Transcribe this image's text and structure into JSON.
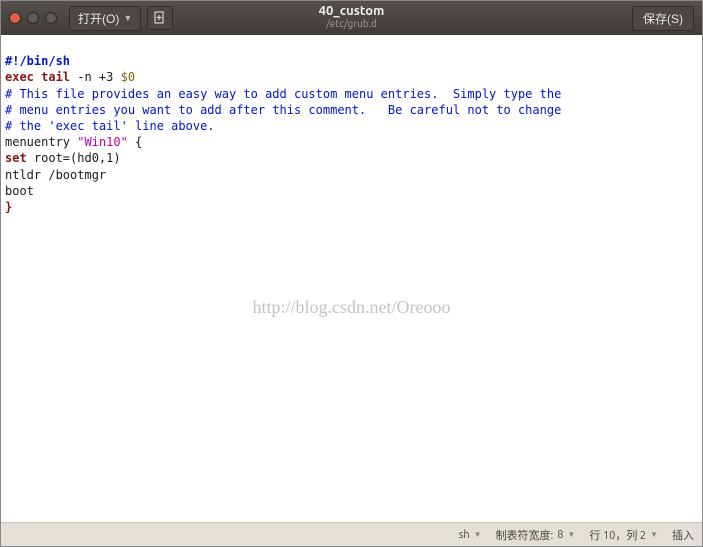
{
  "titlebar": {
    "open_label": "打开(O)",
    "title": "40_custom",
    "subtitle": "/etc/grub.d",
    "save_label": "保存(S)"
  },
  "code": {
    "l1_shebang": "#!/bin/sh",
    "l2_kw": "exec tail",
    "l2_rest": " -n +3 ",
    "l2_arg": "$0",
    "l3": "# This file provides an easy way to add custom menu entries.  Simply type the",
    "l4": "# menu entries you want to add after this comment.   Be careful not to change",
    "l5": "# the 'exec tail' line above.",
    "l6_a": "menuentry ",
    "l6_str": "\"Win10\"",
    "l6_c": " {",
    "l7_kw": "set",
    "l7_rest": " root=(hd0,1)",
    "l8": "ntldr /bootmgr",
    "l9": "boot",
    "l10": "}"
  },
  "watermark": "http://blog.csdn.net/Oreooo",
  "status": {
    "language": "sh",
    "tabwidth_label": "制表符宽度:",
    "tabwidth_value": "8",
    "cursor": "行 10，列 2",
    "insert_mode": "插入"
  }
}
